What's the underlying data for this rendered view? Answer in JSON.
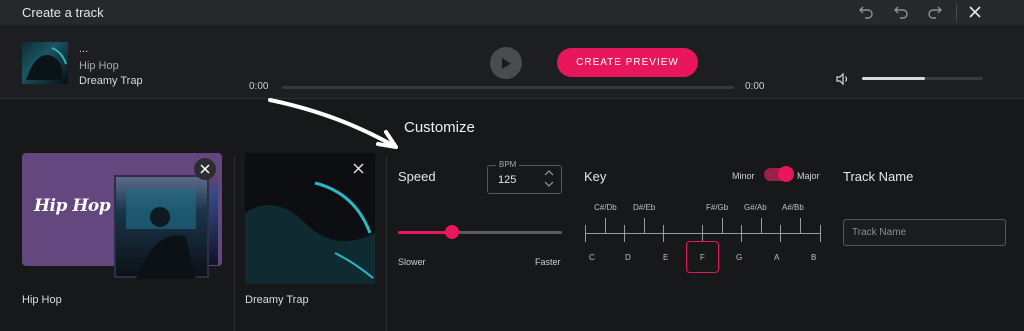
{
  "window": {
    "title": "Create a track",
    "icons": [
      "redo-back-icon",
      "undo-icon",
      "redo-icon",
      "close-icon"
    ]
  },
  "player": {
    "track_title": "...",
    "genre": "Hip Hop",
    "style": "Dreamy Trap",
    "time_current": "0:00",
    "time_total": "0:00",
    "progress_fraction": 0,
    "play_icon": "play-icon",
    "create_preview_label": "CREATE PREVIEW",
    "volume_fraction": 0.52,
    "volume_icon": "speaker-icon",
    "accent_color": "#e8165a"
  },
  "customize": {
    "heading": "Customize",
    "selected_cards": [
      {
        "label": "Hip Hop",
        "logo_text": "Hip Hop"
      },
      {
        "label": "Dreamy Trap"
      }
    ],
    "speed": {
      "label": "Speed",
      "bpm_label": "BPM",
      "bpm_value": "125",
      "slider_fraction": 0.33,
      "slower_label": "Slower",
      "faster_label": "Faster"
    },
    "key": {
      "label": "Key",
      "minor_label": "Minor",
      "major_label": "Major",
      "mode": "Major",
      "sharps": [
        "C#/Db",
        "D#/Eb",
        "F#/Gb",
        "G#/Ab",
        "A#/Bb"
      ],
      "naturals": [
        "C",
        "D",
        "E",
        "F",
        "G",
        "A",
        "B"
      ],
      "selected": "F"
    },
    "track_name": {
      "label": "Track Name",
      "placeholder": "Track Name",
      "value": ""
    }
  }
}
